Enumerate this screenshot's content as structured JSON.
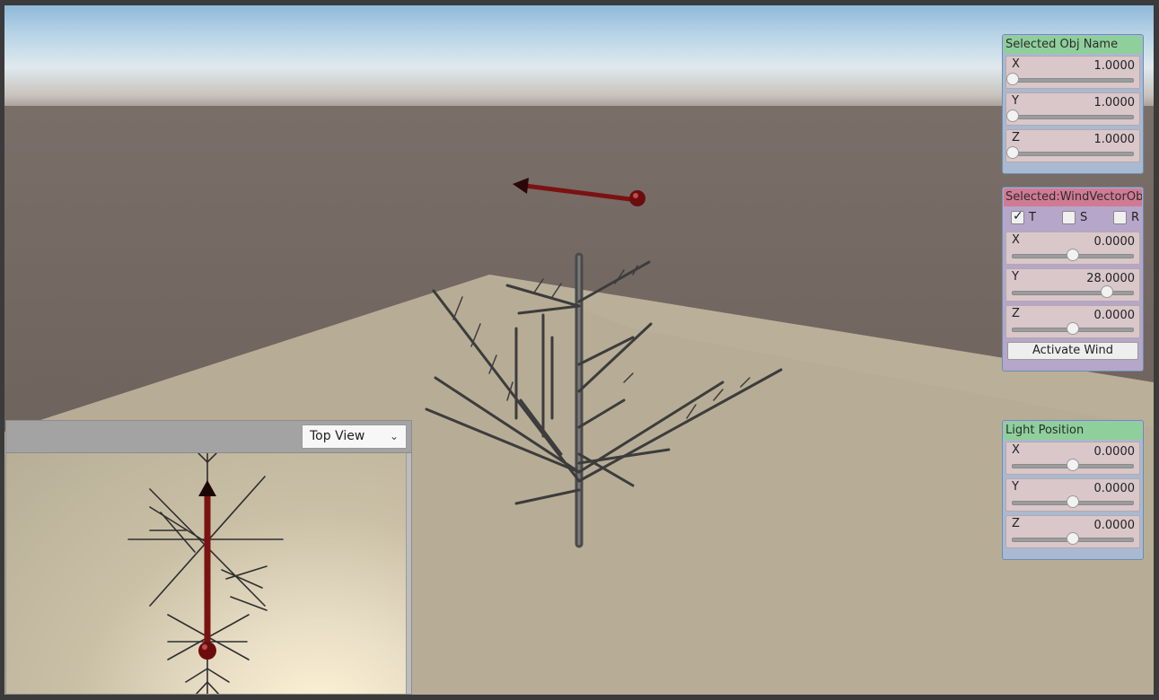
{
  "scene": {
    "name": "3d-viewport",
    "wind_arrow_color": "#7a1212",
    "ground_color": "#c4b9a0"
  },
  "panel_transform": {
    "title": "Selected Obj Name",
    "fields": [
      {
        "label": "X",
        "value": "1.0000",
        "level": 0.0
      },
      {
        "label": "Y",
        "value": "1.0000",
        "level": 0.0
      },
      {
        "label": "Z",
        "value": "1.0000",
        "level": 0.0
      }
    ]
  },
  "panel_wind": {
    "title": "Selected:WindVectorObj",
    "toggles": [
      {
        "label": "T",
        "checked": true
      },
      {
        "label": "S",
        "checked": false
      },
      {
        "label": "R",
        "checked": false
      }
    ],
    "fields": [
      {
        "label": "X",
        "value": "0.0000",
        "level": 0.5
      },
      {
        "label": "Y",
        "value": "28.0000",
        "level": 0.78
      },
      {
        "label": "Z",
        "value": "0.0000",
        "level": 0.5
      }
    ],
    "button_label": "Activate Wind"
  },
  "panel_light": {
    "title": "Light Position",
    "fields": [
      {
        "label": "X",
        "value": "0.0000",
        "level": 0.5
      },
      {
        "label": "Y",
        "value": "0.0000",
        "level": 0.5
      },
      {
        "label": "Z",
        "value": "0.0000",
        "level": 0.5
      }
    ]
  },
  "top_view": {
    "dropdown_value": "Top View"
  },
  "colors": {
    "green_header": "#8fcf9b",
    "pink_header": "#d07b93",
    "panel_blue": "#a9b9d2",
    "panel_purple": "#b6a6c9"
  }
}
